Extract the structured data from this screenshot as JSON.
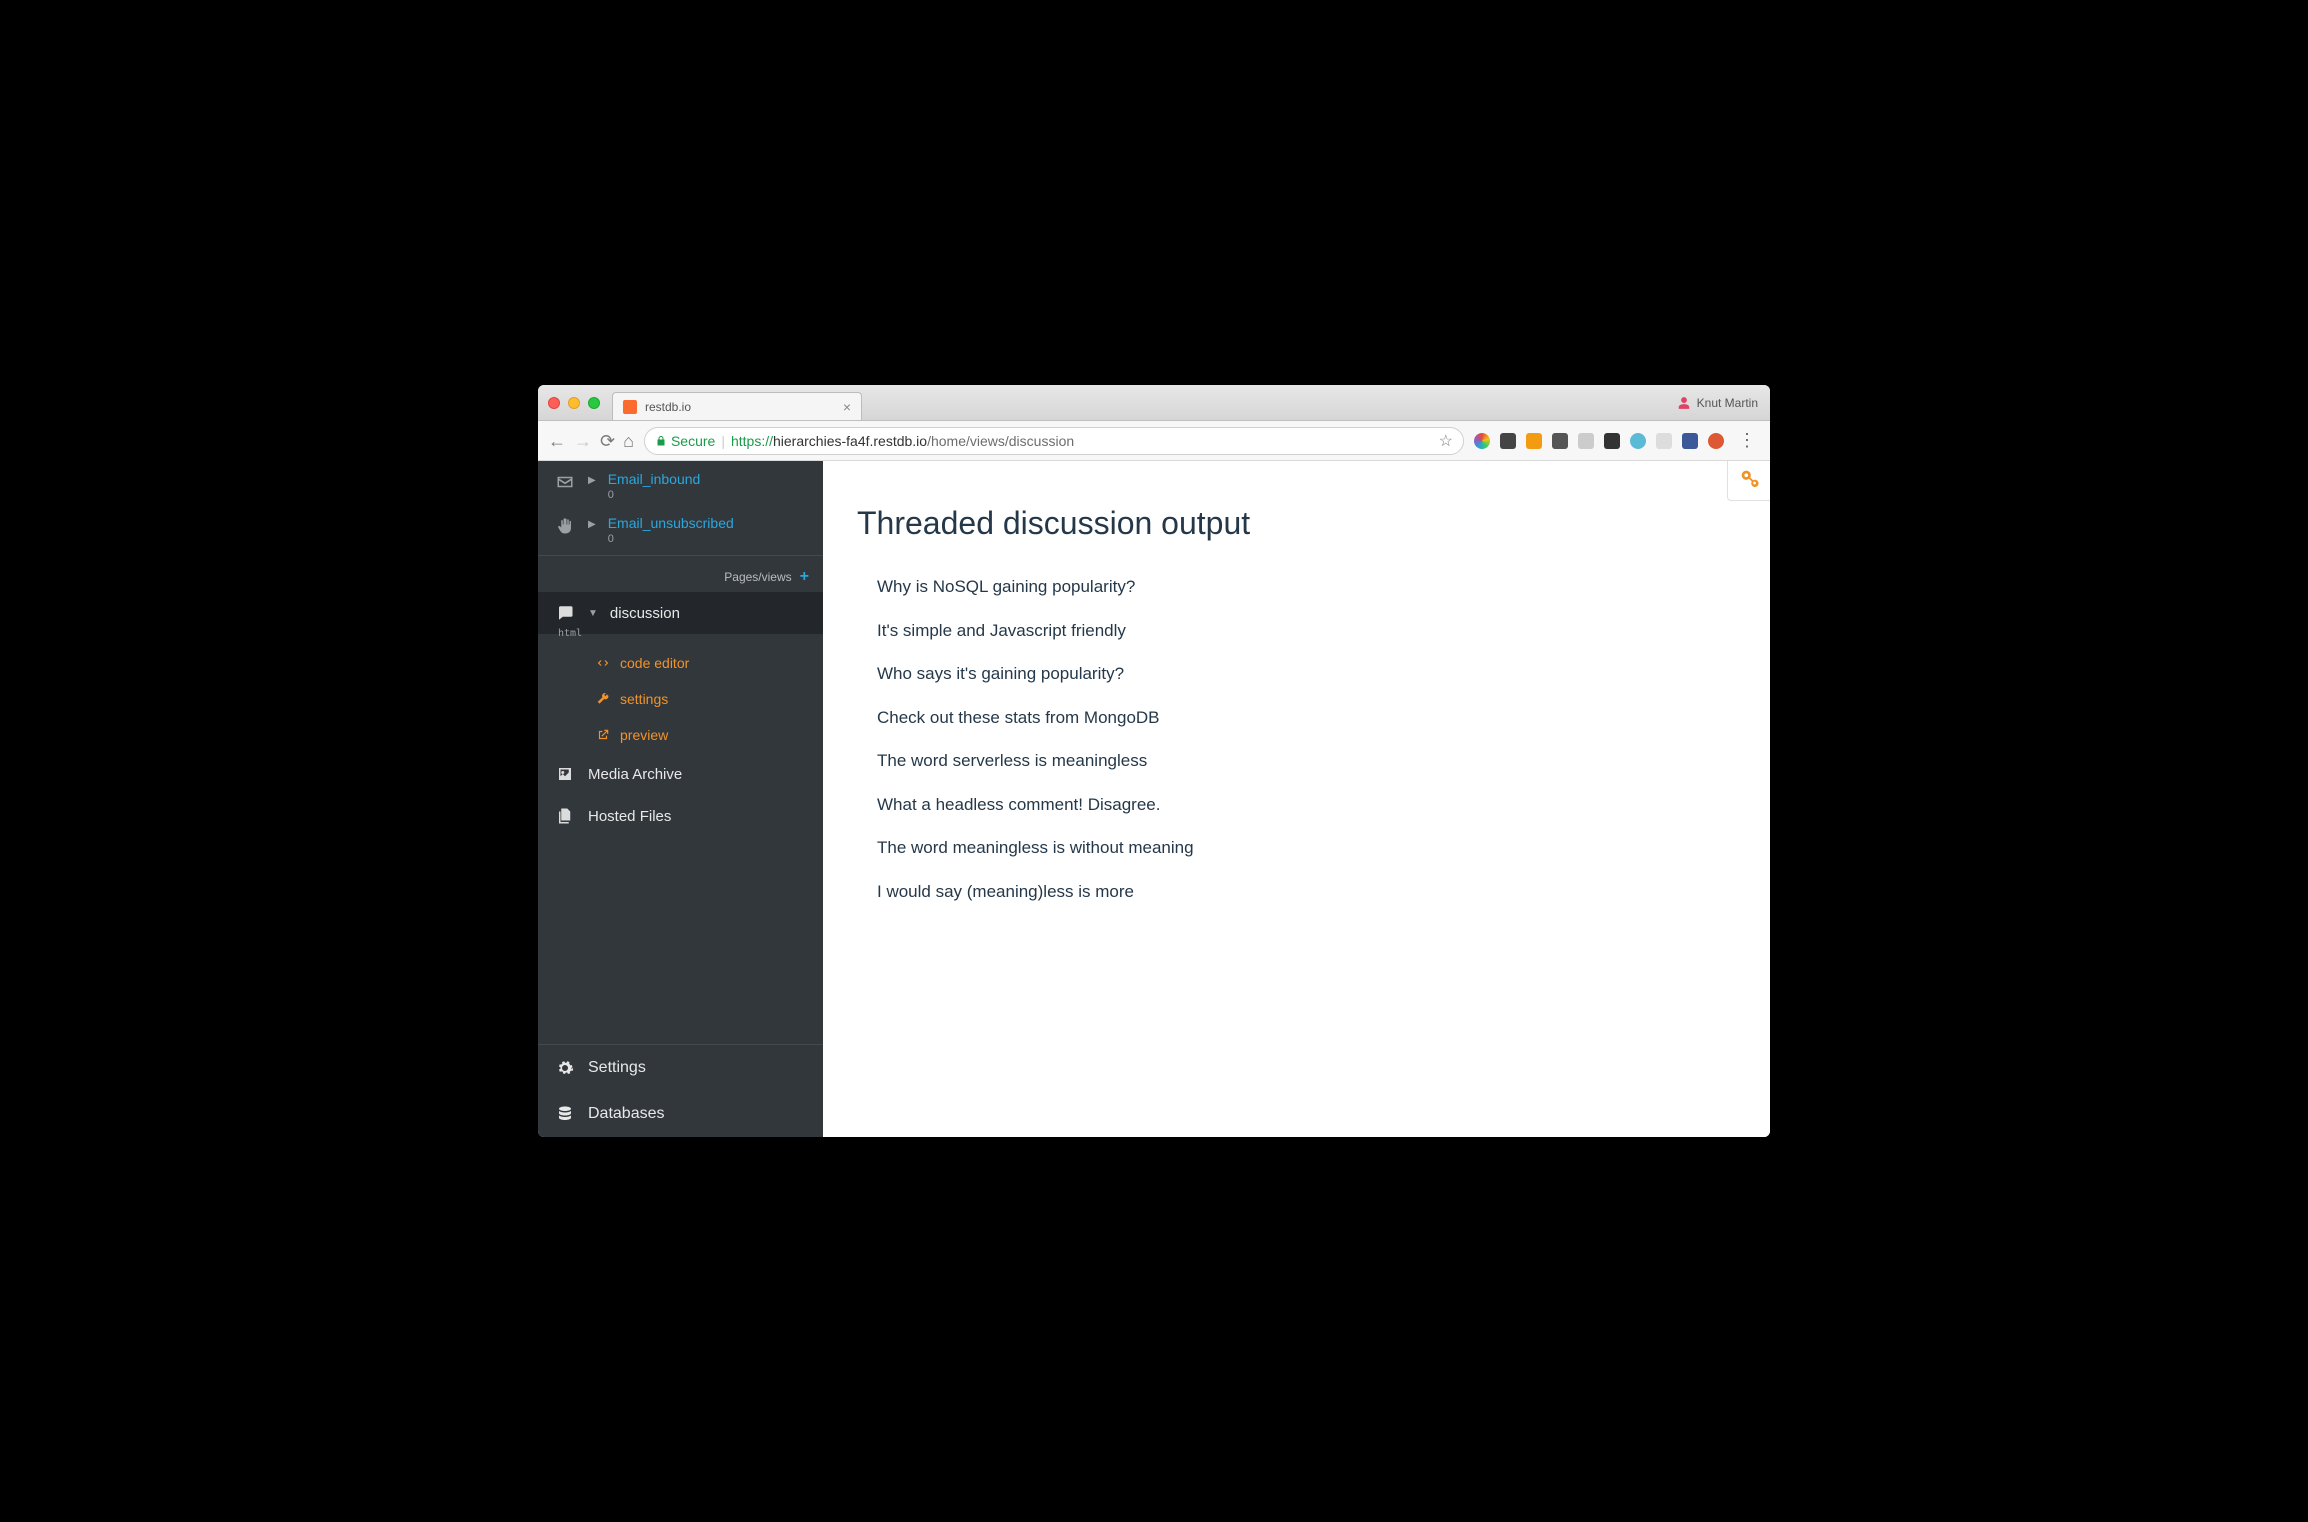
{
  "browser": {
    "tab_title": "restdb.io",
    "user_name": "Knut Martin",
    "secure_label": "Secure",
    "url_proto": "https://",
    "url_host": "hierarchies-fa4f.restdb.io",
    "url_path": "/home/views/discussion"
  },
  "sidebar": {
    "collections": [
      {
        "name": "Email_inbound",
        "count": "0",
        "icon": "mail"
      },
      {
        "name": "Email_unsubscribed",
        "count": "0",
        "icon": "hand"
      }
    ],
    "pages_header": "Pages/views",
    "active_view": {
      "label": "discussion",
      "badge": "html",
      "sub": [
        {
          "label": "code editor",
          "icon": "code"
        },
        {
          "label": "settings",
          "icon": "wrench"
        },
        {
          "label": "preview",
          "icon": "external"
        }
      ]
    },
    "items": [
      {
        "label": "Media Archive",
        "icon": "image"
      },
      {
        "label": "Hosted Files",
        "icon": "files"
      }
    ],
    "footer": [
      {
        "label": "Settings",
        "icon": "gear"
      },
      {
        "label": "Databases",
        "icon": "db"
      }
    ]
  },
  "main": {
    "title": "Threaded discussion output",
    "threads": [
      {
        "text": "Why is NoSQL gaining popularity?",
        "children": [
          {
            "text": "It's simple and Javascript friendly",
            "children": []
          },
          {
            "text": "Who says it's gaining popularity?",
            "children": [
              {
                "text": "Check out these stats from MongoDB",
                "children": []
              }
            ]
          }
        ]
      },
      {
        "text": "The word serverless is meaningless",
        "children": [
          {
            "text": "What a headless comment! Disagree.",
            "children": []
          },
          {
            "text": "The word meaningless is without meaning",
            "children": [
              {
                "text": "I would say (meaning)less is more",
                "children": []
              }
            ]
          }
        ]
      }
    ]
  }
}
